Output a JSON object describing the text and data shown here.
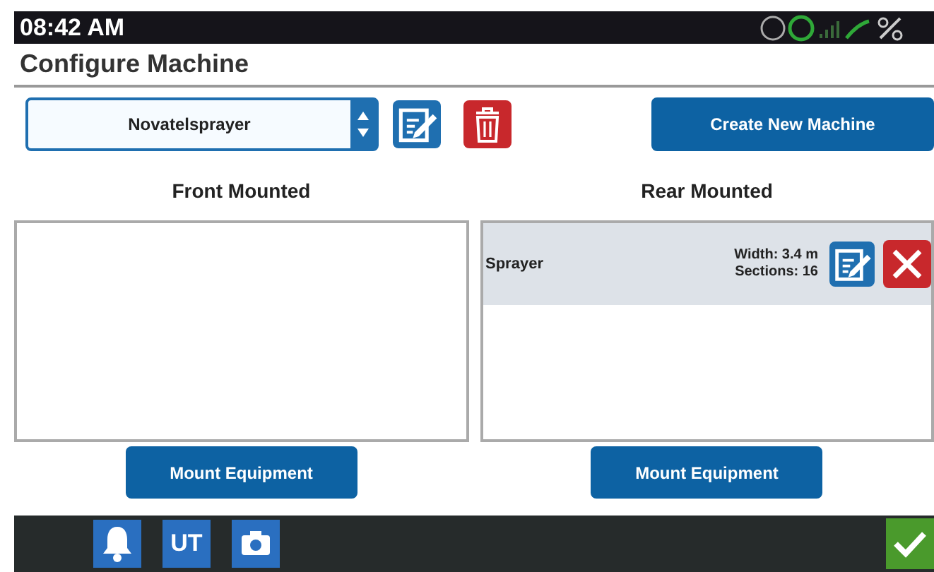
{
  "status_bar": {
    "time": "08:42 AM"
  },
  "title": "Configure Machine",
  "machine_select": {
    "value": "Novatelsprayer"
  },
  "create_button": "Create New Machine",
  "columns": [
    {
      "heading": "Front Mounted",
      "button": "Mount Equipment"
    },
    {
      "heading": "Rear Mounted",
      "items": [
        {
          "name": "Sprayer",
          "width": "Width: 3.4 m",
          "sections": "Sections: 16",
          "selected": true
        }
      ],
      "button": "Mount Equipment"
    }
  ],
  "taskbar": {
    "ut_label": "UT"
  }
}
